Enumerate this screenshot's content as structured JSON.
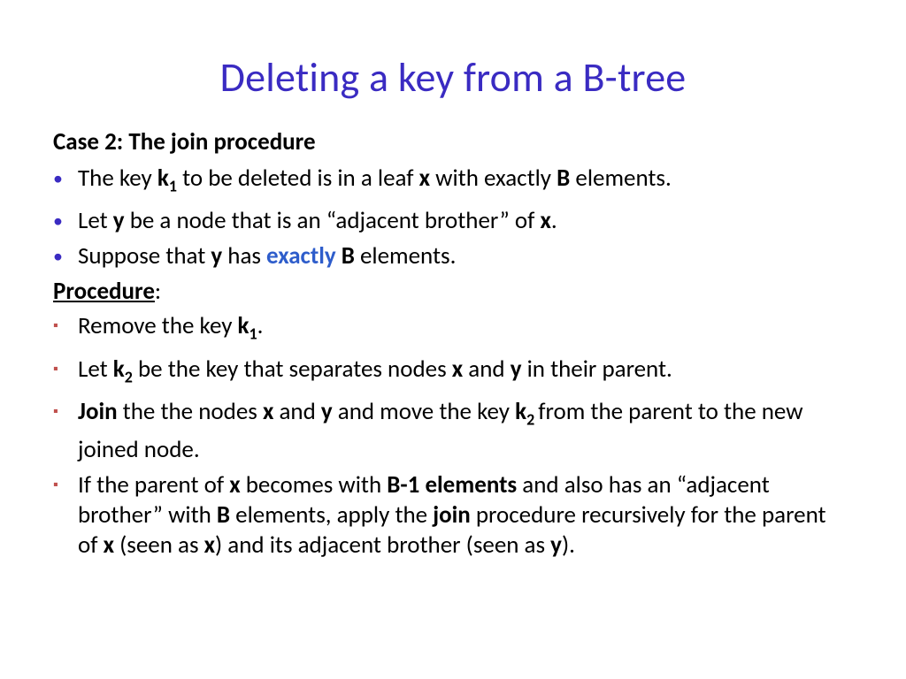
{
  "title": "Deleting a key from a B-tree",
  "case": {
    "label_prefix": "Case 2:",
    "label_rest": "  The join procedure"
  },
  "bullets_top": {
    "b1": {
      "t1": "The key ",
      "k1": "k",
      "k1sub": "1",
      "t2": " to be deleted is in a leaf ",
      "x": "x",
      "t3": " with exactly ",
      "B": "B",
      "t4": " elements."
    },
    "b2": {
      "t1": "Let ",
      "y": "y",
      "t2": " be a node that is an “adjacent brother” of ",
      "x": "x",
      "t3": "."
    },
    "b3": {
      "t1": "Suppose that ",
      "y": "y",
      "t2": " has ",
      "exactly": "exactly",
      "sp": " ",
      "B": "B",
      "t3": " elements."
    }
  },
  "procedure_label": "Procedure",
  "procedure_colon": ":",
  "bullets_proc": {
    "p1": {
      "t1": "Remove the key ",
      "k1": "k",
      "k1sub": "1",
      "t2": "."
    },
    "p2": {
      "t1": "Let ",
      "k2": "k",
      "k2sub": "2",
      "t2": " be the key that separates nodes ",
      "x": "x",
      "t3": " and ",
      "y": "y",
      "t4": " in their parent."
    },
    "p3": {
      "join": "Join",
      "t1": " the the nodes ",
      "x": "x",
      "t2": " and ",
      "y": "y",
      "t3": " and move the key ",
      "k2": "k",
      "k2sub": "2 ",
      "t4": "from the parent to the new joined node."
    },
    "p4": {
      "t1": "If the parent of ",
      "x1": "x",
      "t2": " becomes with ",
      "bm1": "B-1 elements",
      "t3": " and also has an “adjacent brother” with ",
      "B": "B",
      "t4": " elements,  apply the  ",
      "join": "join",
      "t5": " procedure recursively for the parent of ",
      "x2": "x",
      "t6": " (seen as ",
      "x3": "x",
      "t7": ") and its adjacent brother (seen as ",
      "y": "y",
      "t8": ")."
    }
  }
}
